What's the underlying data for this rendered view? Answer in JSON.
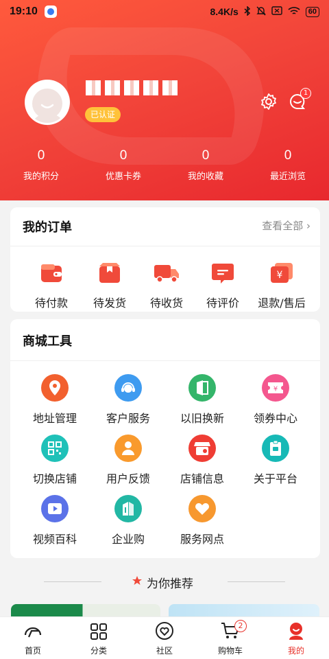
{
  "status_bar": {
    "time": "19:10",
    "speed": "8.4K/s",
    "battery": "60"
  },
  "profile": {
    "verified_label": "已认证",
    "message_badge": "1"
  },
  "stats": [
    {
      "value": "0",
      "label": "我的积分"
    },
    {
      "value": "0",
      "label": "优惠卡券"
    },
    {
      "value": "0",
      "label": "我的收藏"
    },
    {
      "value": "0",
      "label": "最近浏览"
    }
  ],
  "orders": {
    "title": "我的订单",
    "see_all": "查看全部",
    "items": [
      {
        "label": "待付款",
        "icon": "wallet-icon"
      },
      {
        "label": "待发货",
        "icon": "package-icon"
      },
      {
        "label": "待收货",
        "icon": "truck-icon"
      },
      {
        "label": "待评价",
        "icon": "comment-icon"
      },
      {
        "label": "退款/售后",
        "icon": "refund-icon"
      }
    ]
  },
  "tools": {
    "title": "商城工具",
    "items": [
      {
        "label": "地址管理",
        "icon": "location-pin-icon",
        "color": "#f2602e"
      },
      {
        "label": "客户服务",
        "icon": "headset-icon",
        "color": "#3e9bf0"
      },
      {
        "label": "以旧换新",
        "icon": "exchange-icon",
        "color": "#34b56a"
      },
      {
        "label": "领券中心",
        "icon": "coupon-icon",
        "color": "#f4578e"
      },
      {
        "label": "切换店铺",
        "icon": "qrcode-icon",
        "color": "#1fc1b8"
      },
      {
        "label": "用户反馈",
        "icon": "user-icon",
        "color": "#f99a2d"
      },
      {
        "label": "店铺信息",
        "icon": "store-icon",
        "color": "#ef3d34"
      },
      {
        "label": "关于平台",
        "icon": "badge-icon",
        "color": "#17b9b6"
      },
      {
        "label": "视频百科",
        "icon": "video-icon",
        "color": "#5b72e8"
      },
      {
        "label": "企业购",
        "icon": "building-icon",
        "color": "#22b7a4"
      },
      {
        "label": "服务网点",
        "icon": "heart-hand-icon",
        "color": "#f7982f"
      }
    ]
  },
  "recommend": {
    "title": "为你推荐"
  },
  "tabbar": {
    "items": [
      {
        "label": "首页",
        "icon": "home-logo-icon"
      },
      {
        "label": "分类",
        "icon": "category-grid-icon"
      },
      {
        "label": "社区",
        "icon": "community-heart-icon"
      },
      {
        "label": "购物车",
        "icon": "cart-icon",
        "badge": "2"
      },
      {
        "label": "我的",
        "icon": "profile-icon",
        "active": true
      }
    ]
  },
  "colors": {
    "brand": "#e8312a",
    "header_start": "#ff5a3c",
    "header_end": "#e8282e",
    "verified": "#ffc23a"
  }
}
